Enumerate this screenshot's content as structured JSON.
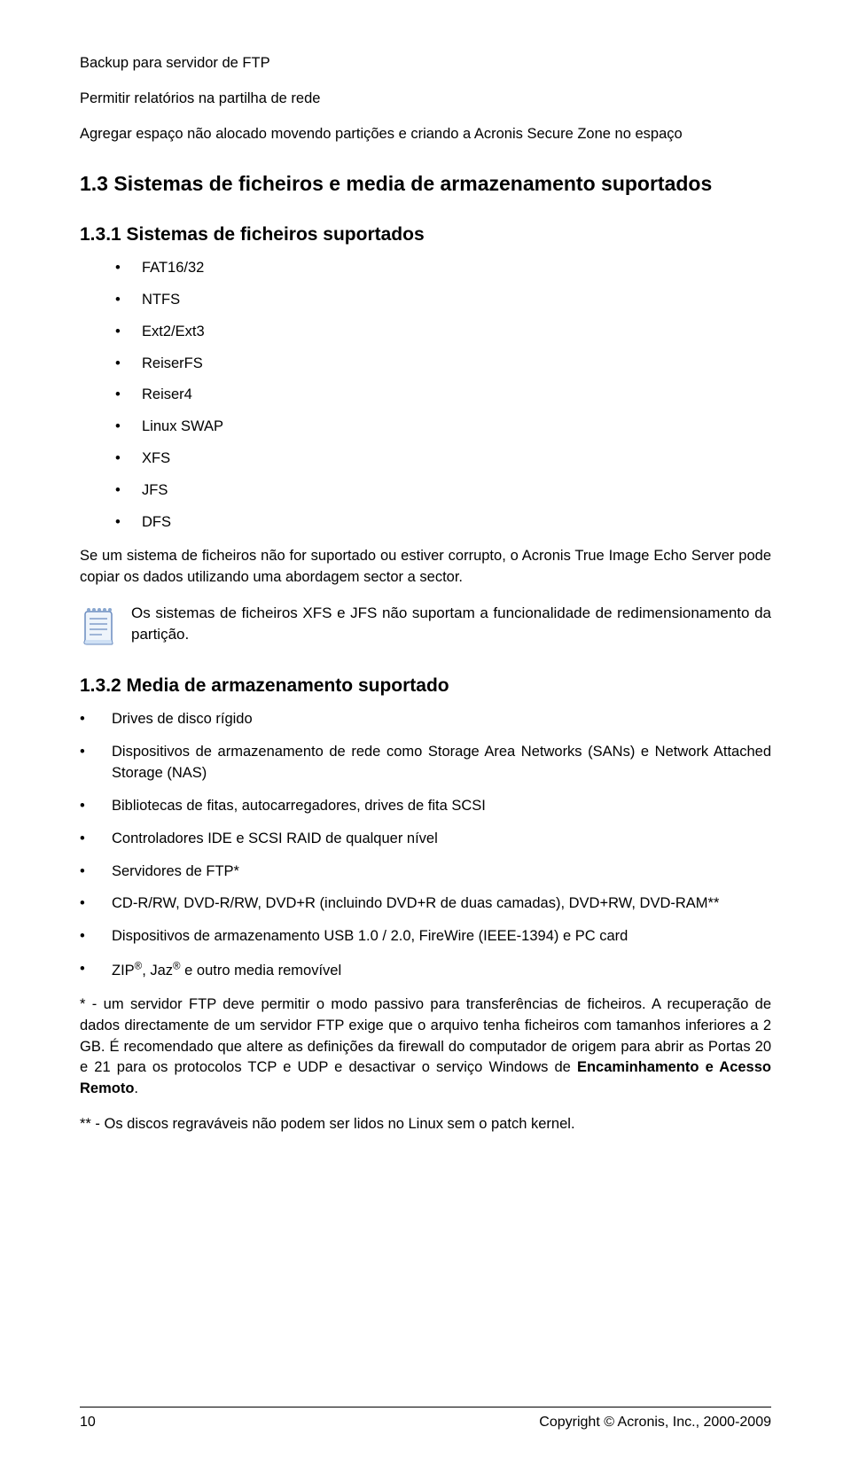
{
  "top": {
    "p1": "Backup para servidor de FTP",
    "p2": "Permitir relatórios na partilha de rede",
    "p3": "Agregar espaço não alocado movendo partições e criando a Acronis Secure Zone no espaço"
  },
  "s13": {
    "heading": "1.3 Sistemas de ficheiros e media de armazenamento suportados"
  },
  "s131": {
    "heading": "1.3.1 Sistemas de ficheiros suportados",
    "items": [
      "FAT16/32",
      "NTFS",
      "Ext2/Ext3",
      "ReiserFS",
      "Reiser4",
      "Linux SWAP",
      "XFS",
      "JFS",
      "DFS"
    ],
    "after": "Se um sistema de ficheiros não for suportado ou estiver corrupto, o Acronis True Image Echo Server pode copiar os dados utilizando uma abordagem sector a sector.",
    "note": "Os sistemas de ficheiros XFS e JFS não suportam a funcionalidade de redimensionamento da partição."
  },
  "s132": {
    "heading": "1.3.2 Media de armazenamento suportado",
    "items": [
      "Drives de disco rígido",
      "Dispositivos de armazenamento de rede como Storage Area Networks (SANs) e Network Attached Storage (NAS)",
      "Bibliotecas de fitas, autocarregadores, drives de fita SCSI",
      "Controladores IDE e SCSI RAID de qualquer nível",
      "Servidores de FTP*",
      "CD-R/RW, DVD-R/RW, DVD+R (incluindo DVD+R de duas camadas), DVD+RW, DVD-RAM**",
      "Dispositivos de armazenamento USB 1.0 / 2.0, FireWire (IEEE-1394) e PC card",
      "ZIP®, Jaz® e outro media removível"
    ],
    "foot1a": "* - um servidor FTP deve permitir o modo passivo para transferências de ficheiros. A recuperação de dados directamente de um servidor FTP exige que o arquivo tenha ficheiros com tamanhos inferiores a 2 GB. É recomendado que altere as definições da firewall do computador de origem para abrir as Portas 20 e 21 para os protocolos TCP e UDP e desactivar o serviço Windows de ",
    "foot1b": "Encaminhamento e Acesso Remoto",
    "foot1c": ".",
    "foot2": "** - Os discos regraváveis não podem ser lidos no Linux sem o patch kernel."
  },
  "footer": {
    "page": "10",
    "copyright": "Copyright © Acronis, Inc., 2000-2009"
  },
  "icons": {
    "note": "notepad-icon"
  }
}
